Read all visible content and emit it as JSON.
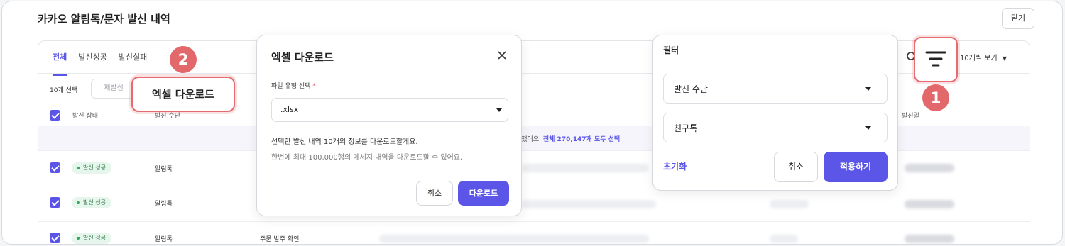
{
  "page": {
    "title": "카카오 알림톡/문자 발신 내역",
    "close_label": "닫기"
  },
  "tabs": [
    {
      "label": "전체",
      "active": true
    },
    {
      "label": "발신성공",
      "active": false
    },
    {
      "label": "발신실패",
      "active": false
    }
  ],
  "toolbar": {
    "view_count": "10개씩 보기",
    "selected_count": "10개 선택",
    "resend_label": "재발신"
  },
  "table": {
    "headers": {
      "status": "발신 상태",
      "method": "발신 수단",
      "date": "발신일"
    },
    "notice": {
      "text": "택했어요.",
      "link": "전체 270,147개 모두 선택"
    },
    "rows": [
      {
        "status": "발신 성공",
        "method": "알림톡",
        "content": ""
      },
      {
        "status": "발신 성공",
        "method": "알림톡",
        "content": ""
      },
      {
        "status": "발신 성공",
        "method": "알림톡",
        "content": "주문 발주 확인"
      }
    ]
  },
  "callouts": {
    "excel_label": "엑셀 다운로드",
    "badge_1": "1",
    "badge_2": "2"
  },
  "excel_modal": {
    "title": "엑셀 다운로드",
    "field_label": "파일 유형 선택",
    "required_mark": "*",
    "file_type": ".xlsx",
    "desc_line1": "선택한 발신 내역 10개의 정보를 다운로드할게요.",
    "desc_line2": "한번에 최대 100,000행의 메세지 내역을 다운로드할 수 있어요.",
    "cancel_label": "취소",
    "download_label": "다운로드"
  },
  "filter_panel": {
    "title": "필터",
    "method_placeholder": "발신 수단",
    "method_value": "친구톡",
    "reset_label": "초기화",
    "cancel_label": "취소",
    "apply_label": "적용하기"
  },
  "colors": {
    "accent": "#5b55e8",
    "highlight": "#e2686b",
    "success_badge_bg": "#e7f6ec"
  }
}
